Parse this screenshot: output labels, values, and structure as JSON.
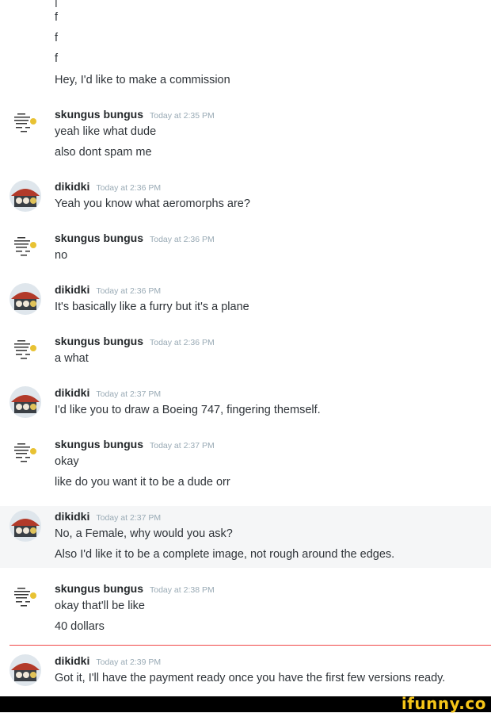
{
  "top_lines": [
    "f",
    "f",
    "f",
    "Hey, I'd like to make a commission"
  ],
  "messages": [
    {
      "user": "skungus bungus",
      "time": "Today at 2:35 PM",
      "lines": [
        "yeah like what dude",
        "also dont spam me"
      ]
    },
    {
      "user": "dikidki",
      "time": "Today at 2:36 PM",
      "lines": [
        "Yeah you know what aeromorphs are?"
      ]
    },
    {
      "user": "skungus bungus",
      "time": "Today at 2:36 PM",
      "lines": [
        "no"
      ]
    },
    {
      "user": "dikidki",
      "time": "Today at 2:36 PM",
      "lines": [
        "It's basically like a furry but it's a plane"
      ]
    },
    {
      "user": "skungus bungus",
      "time": "Today at 2:36 PM",
      "lines": [
        "a what"
      ]
    },
    {
      "user": "dikidki",
      "time": "Today at 2:37 PM",
      "lines": [
        "I'd like you to draw a Boeing 747, fingering themself."
      ]
    },
    {
      "user": "skungus bungus",
      "time": "Today at 2:37 PM",
      "lines": [
        "okay",
        "like do you want it to be a dude orr"
      ]
    },
    {
      "user": "dikidki",
      "time": "Today at 2:37 PM",
      "lines": [
        "No, a Female, why would you ask?",
        "Also I'd like it to be a complete image, not rough around the edges."
      ]
    },
    {
      "user": "skungus bungus",
      "time": "Today at 2:38 PM",
      "lines": [
        "okay that'll be like",
        "40 dollars"
      ]
    },
    {
      "user": "dikidki",
      "time": "Today at 2:39 PM",
      "lines": [
        "Got it, I'll have the payment ready once you have the first few versions ready."
      ]
    }
  ],
  "watermark": "ifunny.co",
  "colors": {
    "new_message_divider": "#f04747",
    "watermark": "#f5c518"
  }
}
